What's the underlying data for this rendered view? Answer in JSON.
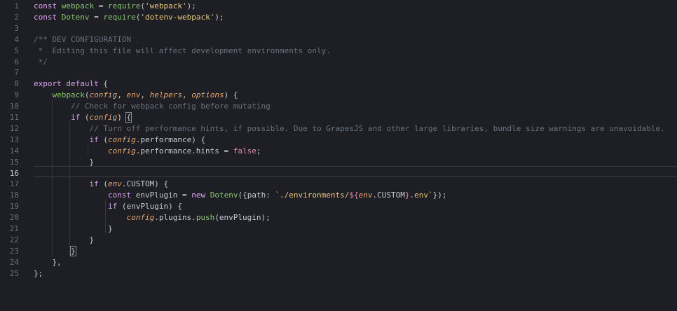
{
  "editor": {
    "active_line": 16,
    "colors": {
      "background": "#1e1f25",
      "line_number": "#6b6f7a",
      "keyword": "#d9a0f0",
      "function": "#85c46c",
      "string": "#e6c77a",
      "comment": "#6b707c",
      "parameter": "#e6a36d"
    },
    "lines": [
      {
        "n": "1",
        "tokens": [
          [
            "kw",
            "const "
          ],
          [
            "fn",
            "webpack"
          ],
          [
            "pl",
            " = "
          ],
          [
            "fn",
            "require"
          ],
          [
            "pl",
            "("
          ],
          [
            "str",
            "'webpack'"
          ],
          [
            "pl",
            ");"
          ]
        ]
      },
      {
        "n": "2",
        "tokens": [
          [
            "kw",
            "const "
          ],
          [
            "fn",
            "Dotenv"
          ],
          [
            "pl",
            " = "
          ],
          [
            "fn",
            "require"
          ],
          [
            "pl",
            "("
          ],
          [
            "str",
            "'dotenv-webpack'"
          ],
          [
            "pl",
            ");"
          ]
        ]
      },
      {
        "n": "3",
        "tokens": []
      },
      {
        "n": "4",
        "tokens": [
          [
            "cm",
            "/** DEV CONFIGURATION"
          ]
        ]
      },
      {
        "n": "5",
        "tokens": [
          [
            "cm",
            " *  Editing this file will affect development environments only."
          ]
        ]
      },
      {
        "n": "6",
        "tokens": [
          [
            "cm",
            " */"
          ]
        ]
      },
      {
        "n": "7",
        "tokens": []
      },
      {
        "n": "8",
        "tokens": [
          [
            "kw",
            "export default "
          ],
          [
            "pl",
            "{"
          ]
        ]
      },
      {
        "n": "9",
        "tokens": [
          [
            "pl",
            "    "
          ],
          [
            "fn",
            "webpack"
          ],
          [
            "pl",
            "("
          ],
          [
            "pm",
            "config"
          ],
          [
            "pl",
            ", "
          ],
          [
            "pm",
            "env"
          ],
          [
            "pl",
            ", "
          ],
          [
            "pm",
            "helpers"
          ],
          [
            "pl",
            ", "
          ],
          [
            "pm",
            "options"
          ],
          [
            "pl",
            ") {"
          ]
        ]
      },
      {
        "n": "10",
        "tokens": [
          [
            "pl",
            "        "
          ],
          [
            "cm",
            "// Check for webpack config before mutating"
          ]
        ]
      },
      {
        "n": "11",
        "tokens": [
          [
            "pl",
            "        "
          ],
          [
            "kw",
            "if "
          ],
          [
            "pl",
            "("
          ],
          [
            "pm",
            "config"
          ],
          [
            "pl",
            ") "
          ],
          [
            "bm",
            "{"
          ]
        ]
      },
      {
        "n": "12",
        "tokens": [
          [
            "pl",
            "            "
          ],
          [
            "cm",
            "// Turn off performance hints, if possible. Due to GrapesJS and other large libraries, bundle size warnings are unavoidable."
          ]
        ]
      },
      {
        "n": "13",
        "tokens": [
          [
            "pl",
            "            "
          ],
          [
            "kw",
            "if "
          ],
          [
            "pl",
            "("
          ],
          [
            "pm",
            "config"
          ],
          [
            "pl",
            ".performance) {"
          ]
        ]
      },
      {
        "n": "14",
        "tokens": [
          [
            "pl",
            "                "
          ],
          [
            "pm",
            "config"
          ],
          [
            "pl",
            ".performance.hints = "
          ],
          [
            "kw2",
            "false"
          ],
          [
            "pl",
            ";"
          ]
        ]
      },
      {
        "n": "15",
        "tokens": [
          [
            "pl",
            "            }"
          ]
        ]
      },
      {
        "n": "16",
        "tokens": []
      },
      {
        "n": "17",
        "tokens": [
          [
            "pl",
            "            "
          ],
          [
            "kw",
            "if "
          ],
          [
            "pl",
            "("
          ],
          [
            "pm",
            "env"
          ],
          [
            "pl",
            ".CUSTOM) {"
          ]
        ]
      },
      {
        "n": "18",
        "tokens": [
          [
            "pl",
            "                "
          ],
          [
            "kw",
            "const "
          ],
          [
            "pl",
            "envPlugin = "
          ],
          [
            "kw",
            "new "
          ],
          [
            "fn",
            "Dotenv"
          ],
          [
            "pl",
            "({path: "
          ],
          [
            "str",
            "`./environments/"
          ],
          [
            "tmpl",
            "${"
          ],
          [
            "pm",
            "env"
          ],
          [
            "pl",
            ".CUSTOM"
          ],
          [
            "tmpl",
            "}"
          ],
          [
            "str",
            ".env`"
          ],
          [
            "pl",
            "});"
          ]
        ]
      },
      {
        "n": "19",
        "tokens": [
          [
            "pl",
            "                "
          ],
          [
            "kw",
            "if "
          ],
          [
            "pl",
            "(envPlugin) {"
          ]
        ]
      },
      {
        "n": "20",
        "tokens": [
          [
            "pl",
            "                    "
          ],
          [
            "pm",
            "config"
          ],
          [
            "pl",
            ".plugins."
          ],
          [
            "fn",
            "push"
          ],
          [
            "pl",
            "(envPlugin);"
          ]
        ]
      },
      {
        "n": "21",
        "tokens": [
          [
            "pl",
            "                }"
          ]
        ]
      },
      {
        "n": "22",
        "tokens": [
          [
            "pl",
            "            }"
          ]
        ]
      },
      {
        "n": "23",
        "tokens": [
          [
            "pl",
            "        "
          ],
          [
            "bm",
            "}"
          ]
        ]
      },
      {
        "n": "24",
        "tokens": [
          [
            "pl",
            "    },"
          ]
        ]
      },
      {
        "n": "25",
        "tokens": [
          [
            "pl",
            "};"
          ]
        ]
      }
    ]
  }
}
